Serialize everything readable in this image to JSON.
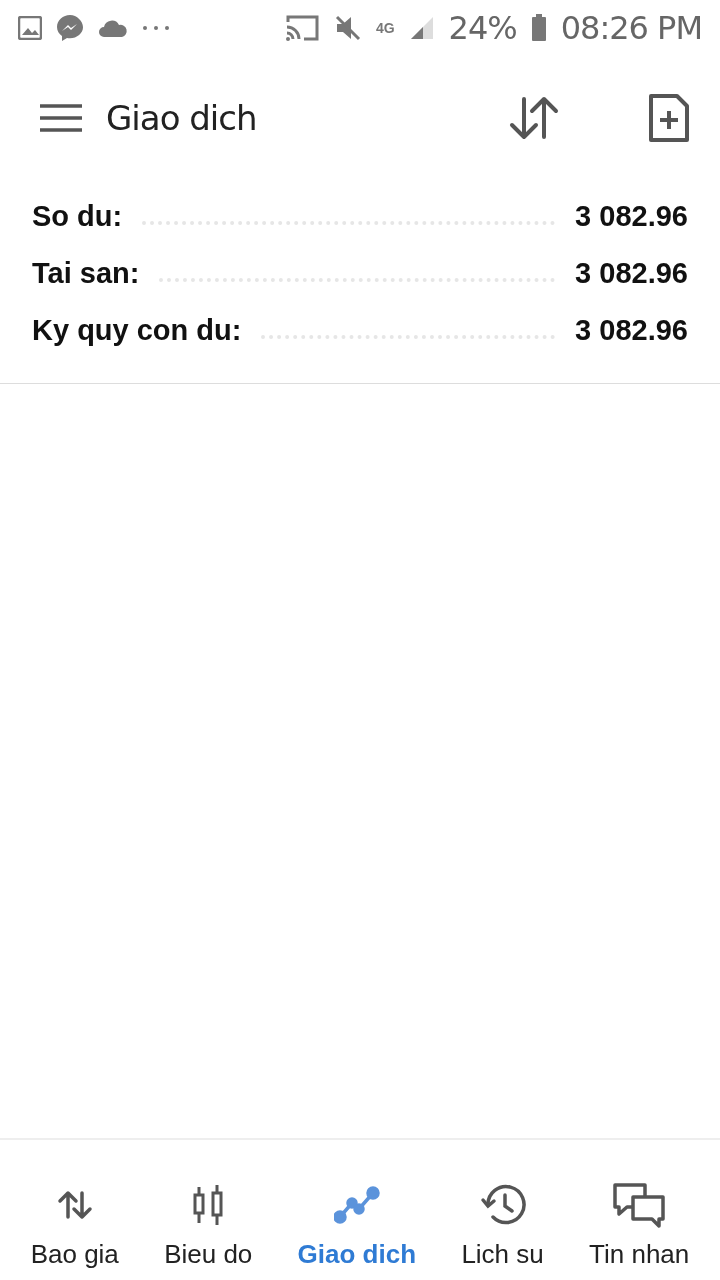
{
  "status_bar": {
    "network": "4G",
    "battery": "24%",
    "time": "08:26 PM"
  },
  "app_bar": {
    "title": "Giao dich"
  },
  "summary": [
    {
      "label": "So du:",
      "value": "3 082.96"
    },
    {
      "label": "Tai san:",
      "value": "3 082.96"
    },
    {
      "label": "Ky quy con du:",
      "value": "3 082.96"
    }
  ],
  "bottom_nav": [
    {
      "label": "Bao gia",
      "kind": "quotes",
      "selected": false
    },
    {
      "label": "Bieu do",
      "kind": "chart",
      "selected": false
    },
    {
      "label": "Giao dich",
      "kind": "trade",
      "selected": true
    },
    {
      "label": "Lich su",
      "kind": "history",
      "selected": false
    },
    {
      "label": "Tin nhan",
      "kind": "messages",
      "selected": false
    }
  ]
}
